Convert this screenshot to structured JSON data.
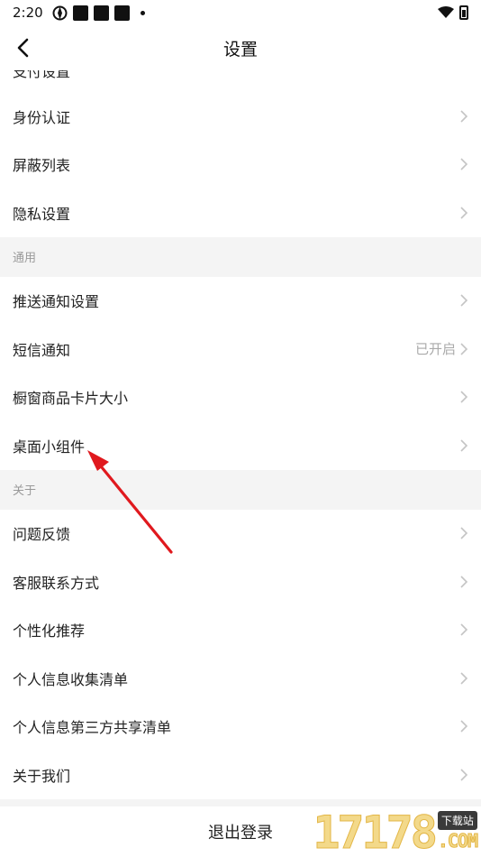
{
  "status_bar": {
    "time": "2:20"
  },
  "nav": {
    "title": "设置"
  },
  "partial_row": "支付设置",
  "rows_top": [
    {
      "label": "身份认证"
    },
    {
      "label": "屏蔽列表"
    },
    {
      "label": "隐私设置"
    }
  ],
  "section_general": "通用",
  "rows_general": [
    {
      "label": "推送通知设置",
      "value": ""
    },
    {
      "label": "短信通知",
      "value": "已开启"
    },
    {
      "label": "橱窗商品卡片大小",
      "value": ""
    },
    {
      "label": "桌面小组件",
      "value": ""
    }
  ],
  "section_about": "关于",
  "rows_about": [
    {
      "label": "问题反馈"
    },
    {
      "label": "客服联系方式"
    },
    {
      "label": "个性化推荐"
    },
    {
      "label": "个人信息收集清单"
    },
    {
      "label": "个人信息第三方共享清单"
    },
    {
      "label": "关于我们"
    }
  ],
  "logout_label": "退出登录",
  "watermark": {
    "digits": "17178",
    "tag": "下载站",
    "com": ".COM"
  },
  "colors": {
    "arrow": "#e0191e",
    "section_bg": "#f4f4f4"
  }
}
